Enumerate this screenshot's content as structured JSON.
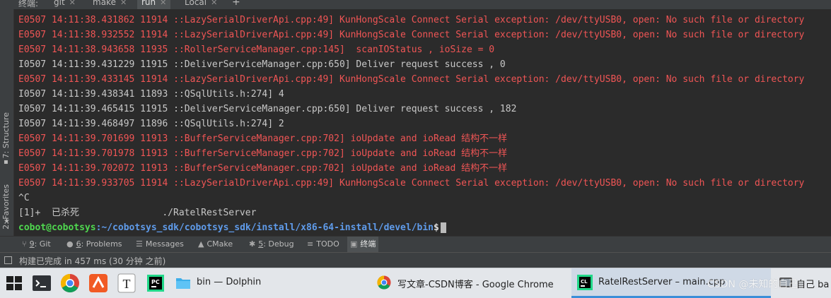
{
  "tabbar": {
    "label": "终端:",
    "tabs": [
      {
        "label": "git"
      },
      {
        "label": "make"
      },
      {
        "label": "run",
        "active": true
      },
      {
        "label": "Local"
      }
    ]
  },
  "left_stripe": {
    "structure": "7: Structure",
    "favorites": "2: Favorites"
  },
  "console": {
    "lines": [
      {
        "kind": "err",
        "text": "E0507 14:11:38.431862 11914 ::LazySerialDriverApi.cpp:49] KunHongScale Connect Serial exception: /dev/ttyUSB0, open: No such file or directory"
      },
      {
        "kind": "err",
        "text": "E0507 14:11:38.932552 11914 ::LazySerialDriverApi.cpp:49] KunHongScale Connect Serial exception: /dev/ttyUSB0, open: No such file or directory"
      },
      {
        "kind": "err",
        "text": "E0507 14:11:38.943658 11935 ::RollerServiceManager.cpp:145]  scanIOStatus , ioSize = 0"
      },
      {
        "kind": "info",
        "text": "I0507 14:11:39.431229 11915 ::DeliverServiceManager.cpp:650] Deliver request success , 0"
      },
      {
        "kind": "err",
        "text": "E0507 14:11:39.433145 11914 ::LazySerialDriverApi.cpp:49] KunHongScale Connect Serial exception: /dev/ttyUSB0, open: No such file or directory"
      },
      {
        "kind": "info",
        "text": "I0507 14:11:39.438341 11893 ::QSqlUtils.h:274] 4"
      },
      {
        "kind": "info",
        "text": "I0507 14:11:39.465415 11915 ::DeliverServiceManager.cpp:650] Deliver request success , 182"
      },
      {
        "kind": "info",
        "text": "I0507 14:11:39.468497 11896 ::QSqlUtils.h:274] 2"
      },
      {
        "kind": "err",
        "text": "E0507 14:11:39.701699 11913 ::BufferServiceManager.cpp:702] ioUpdate and ioRead 结构不一样"
      },
      {
        "kind": "err",
        "text": "E0507 14:11:39.701978 11913 ::BufferServiceManager.cpp:702] ioUpdate and ioRead 结构不一样"
      },
      {
        "kind": "err",
        "text": "E0507 14:11:39.702072 11913 ::BufferServiceManager.cpp:702] ioUpdate and ioRead 结构不一样"
      },
      {
        "kind": "err",
        "text": "E0507 14:11:39.933705 11914 ::LazySerialDriverApi.cpp:49] KunHongScale Connect Serial exception: /dev/ttyUSB0, open: No such file or directory"
      },
      {
        "kind": "info",
        "text": "^C"
      },
      {
        "kind": "info",
        "text": "[1]+  已杀死               ./RatelRestServer"
      }
    ],
    "prompt": {
      "user": "cobot@cobotsys",
      "path": ":~/cobotsys_sdk/cobotsys_sdk/install/x86-64-install/devel/bin",
      "sign": "$"
    }
  },
  "toolwindows": [
    {
      "icon": "git-branch-icon",
      "num": "9",
      "label": ": Git"
    },
    {
      "icon": "problems-icon",
      "num": "6",
      "label": ": Problems"
    },
    {
      "icon": "messages-icon",
      "num": "",
      "label": "Messages"
    },
    {
      "icon": "cmake-icon",
      "num": "",
      "label": "CMake"
    },
    {
      "icon": "debug-icon",
      "num": "5",
      "label": ": Debug"
    },
    {
      "icon": "todo-icon",
      "num": "",
      "label": "TODO"
    },
    {
      "icon": "terminal-icon",
      "num": "",
      "label": "终端",
      "active": true
    }
  ],
  "status": {
    "text": "构建已完成 in 457 ms (30 分钟 之前)"
  },
  "taskbar": {
    "tasks": [
      {
        "icon": "folder-icon",
        "title": "bin — Dolphin"
      },
      {
        "icon": "chrome-icon",
        "title": "写文章-CSDN博客 - Google Chrome"
      },
      {
        "icon": "clion-icon",
        "title": "RatelRestServer – main.cpp",
        "active": true
      },
      {
        "icon": "app-icon",
        "title": "自己 ba"
      }
    ],
    "watermark": "CSDN @未知的自己"
  },
  "colors": {
    "error": "#f05555",
    "info": "#c8c8c8",
    "prompt_user": "#4fd84f",
    "prompt_path": "#5f9bea",
    "accent": "#4a88c7"
  }
}
